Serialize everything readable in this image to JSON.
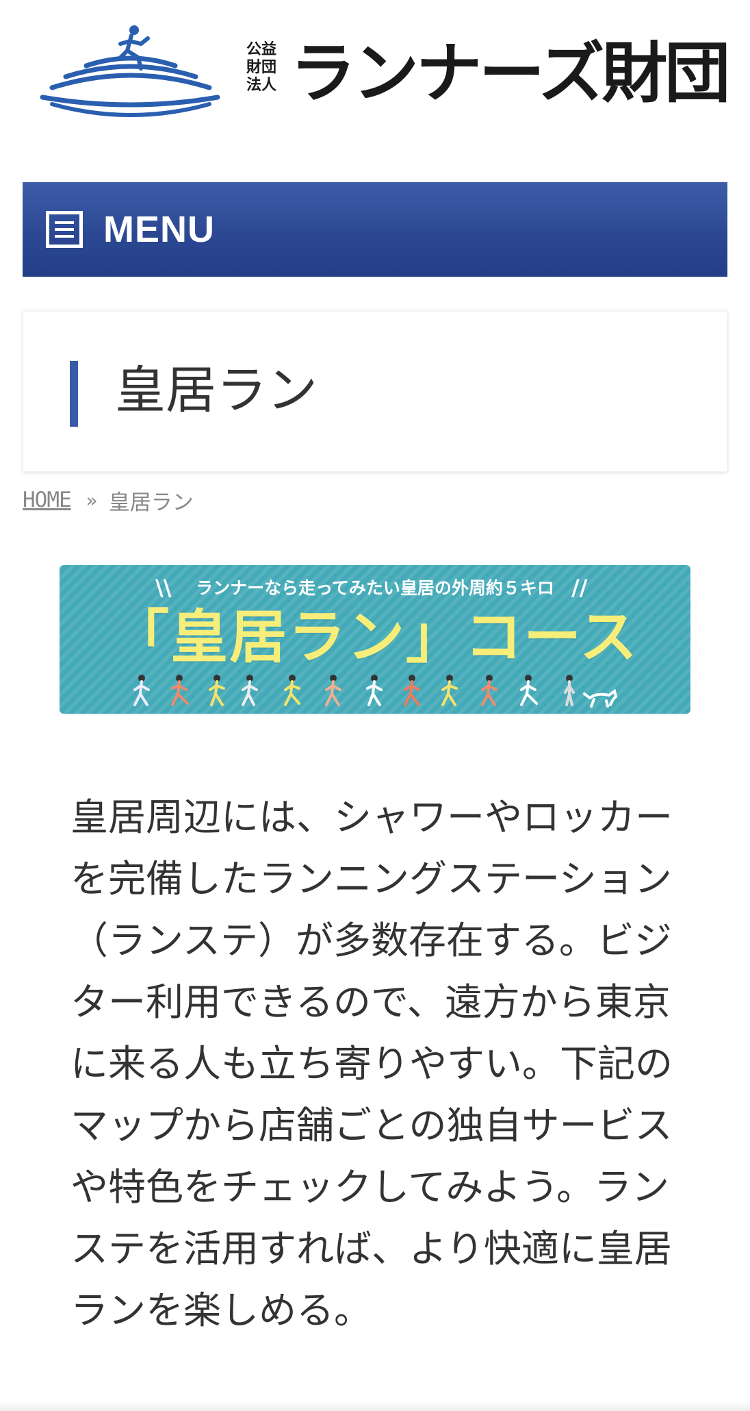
{
  "header": {
    "logo_alt": "公益財団法人ランナーズ財団",
    "logo_sub_lines": [
      "公益",
      "財団",
      "法人"
    ],
    "logo_text": "ランナーズ財団",
    "brand_color": "#2a5fb0"
  },
  "menu": {
    "label": "MENU",
    "icon": "hamburger-icon",
    "bg_color": "#2c4893"
  },
  "page": {
    "title": "皇居ラン",
    "accent_color": "#3a5aa6"
  },
  "breadcrumb": {
    "home": "HOME",
    "separator": "»",
    "current": "皇居ラン"
  },
  "banner": {
    "tagline": "ランナーなら走ってみたい皇居の外周約５キロ",
    "title": "「皇居ラン」コース",
    "bg_color": "#45aab8",
    "title_color": "#f7ee7a"
  },
  "content": {
    "paragraph": "皇居周辺には、シャワーやロッカーを完備したランニングステーション（ランステ）が多数存在する。ビジター利用できるので、遠方から東京に来る人も立ち寄りやすい。下記のマップから店舗ごとの独自サービスや特色をチェックしてみよう。ランステを活用すれば、より快適に皇居ランを楽しめる。"
  }
}
